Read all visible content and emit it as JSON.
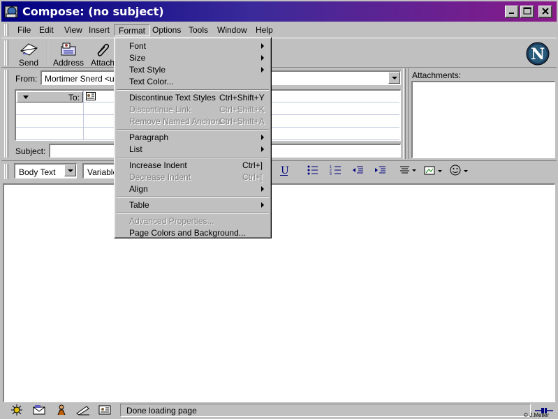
{
  "window": {
    "title": "Compose: (no subject)"
  },
  "menubar": [
    {
      "label": "File",
      "key": "F"
    },
    {
      "label": "Edit",
      "key": "E"
    },
    {
      "label": "View",
      "key": "V"
    },
    {
      "label": "Insert",
      "key": "I"
    },
    {
      "label": "Format",
      "key": "F"
    },
    {
      "label": "Options",
      "key": "O"
    },
    {
      "label": "Tools",
      "key": "T"
    },
    {
      "label": "Window",
      "key": "W"
    },
    {
      "label": "Help",
      "key": "H"
    }
  ],
  "toolbar": {
    "send": "Send",
    "address": "Address",
    "attach": "Attach"
  },
  "header": {
    "from_label": "From:",
    "from_value": "Mortimer Snerd <use",
    "to_label": "To:",
    "subject_label": "Subject:",
    "subject_value": "",
    "attachments_label": "Attachments:"
  },
  "format_bar": {
    "paragraph_style": "Body Text",
    "font": "Variable"
  },
  "format_menu": {
    "font": "Font",
    "size": "Size",
    "text_style": "Text Style",
    "text_color": "Text Color...",
    "discontinue_text_styles": "Discontinue Text Styles",
    "discontinue_text_styles_shortcut": "Ctrl+Shift+Y",
    "discontinue_link": "Discontinue Link",
    "discontinue_link_shortcut": "Ctrl+Shift+K",
    "remove_named_anchors": "Remove Named Anchors",
    "remove_named_anchors_shortcut": "Ctrl+Shift+A",
    "paragraph": "Paragraph",
    "list": "List",
    "increase_indent": "Increase Indent",
    "increase_indent_shortcut": "Ctrl+]",
    "decrease_indent": "Decrease Indent",
    "decrease_indent_shortcut": "Ctrl+[",
    "align": "Align",
    "table": "Table",
    "advanced_properties": "Advanced Properties...",
    "page_colors": "Page Colors and Background..."
  },
  "status": {
    "text": "Done loading page"
  },
  "watermark": "© J.Meller",
  "colors": {
    "title_start": "#000080",
    "title_end": "#8a1a8a",
    "face": "#c0c0c0"
  }
}
